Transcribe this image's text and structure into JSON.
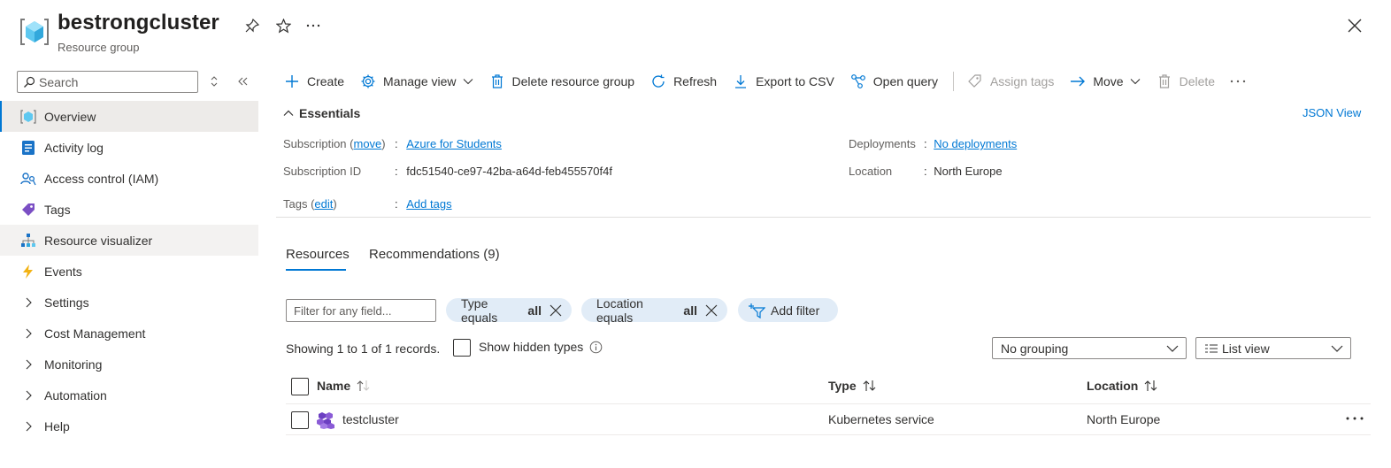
{
  "header": {
    "title": "bestrongcluster",
    "subtitle": "Resource group",
    "icons": [
      "resource-group-icon",
      "pin-icon",
      "star-icon",
      "more-icon",
      "close-icon"
    ]
  },
  "sidebar": {
    "search_placeholder": "Search",
    "items": [
      {
        "label": "Overview",
        "icon": "overview-icon",
        "state": "active"
      },
      {
        "label": "Activity log",
        "icon": "activity-log-icon"
      },
      {
        "label": "Access control (IAM)",
        "icon": "iam-icon"
      },
      {
        "label": "Tags",
        "icon": "tag-icon"
      },
      {
        "label": "Resource visualizer",
        "icon": "visualizer-icon",
        "state": "hover"
      },
      {
        "label": "Events",
        "icon": "lightning-icon"
      },
      {
        "label": "Settings",
        "icon": "chevron-right-icon"
      },
      {
        "label": "Cost Management",
        "icon": "chevron-right-icon"
      },
      {
        "label": "Monitoring",
        "icon": "chevron-right-icon"
      },
      {
        "label": "Automation",
        "icon": "chevron-right-icon"
      },
      {
        "label": "Help",
        "icon": "chevron-right-icon"
      }
    ]
  },
  "toolbar": {
    "create": "Create",
    "manage_view": "Manage view",
    "delete_rg": "Delete resource group",
    "refresh": "Refresh",
    "export_csv": "Export to CSV",
    "open_query": "Open query",
    "assign_tags": "Assign tags",
    "move": "Move",
    "delete": "Delete"
  },
  "essentials": {
    "heading": "Essentials",
    "json_view": "JSON View",
    "subscription_label": "Subscription (",
    "subscription_move": "move",
    "subscription_label_end": ")",
    "subscription_value": "Azure for Students",
    "subscription_id_label": "Subscription ID",
    "subscription_id_value": "fdc51540-ce97-42ba-a64d-feb455570f4f",
    "tags_label": "Tags (",
    "tags_edit": "edit",
    "tags_label_end": ")",
    "tags_value": "Add tags",
    "deployments_label": "Deployments",
    "deployments_value": "No deployments",
    "location_label": "Location",
    "location_value": "North Europe",
    "colon": ":"
  },
  "tabs": {
    "resources": "Resources",
    "recommendations": "Recommendations (9)"
  },
  "filters": {
    "placeholder": "Filter for any field...",
    "type_prefix": "Type equals",
    "type_value": "all",
    "location_prefix": "Location equals",
    "location_value": "all",
    "add_filter": "Add filter"
  },
  "listing": {
    "records": "Showing 1 to 1 of 1 records.",
    "show_hidden": "Show hidden types",
    "grouping": "No grouping",
    "view": "List view"
  },
  "table": {
    "columns": [
      "Name",
      "Type",
      "Location"
    ],
    "rows": [
      {
        "name": "testcluster",
        "type": "Kubernetes service",
        "location": "North Europe",
        "icon": "kubernetes-icon"
      }
    ]
  },
  "colors": {
    "accent": "#0078d4",
    "pill_bg": "#e1ecf7",
    "active_bg": "#edebe9"
  }
}
